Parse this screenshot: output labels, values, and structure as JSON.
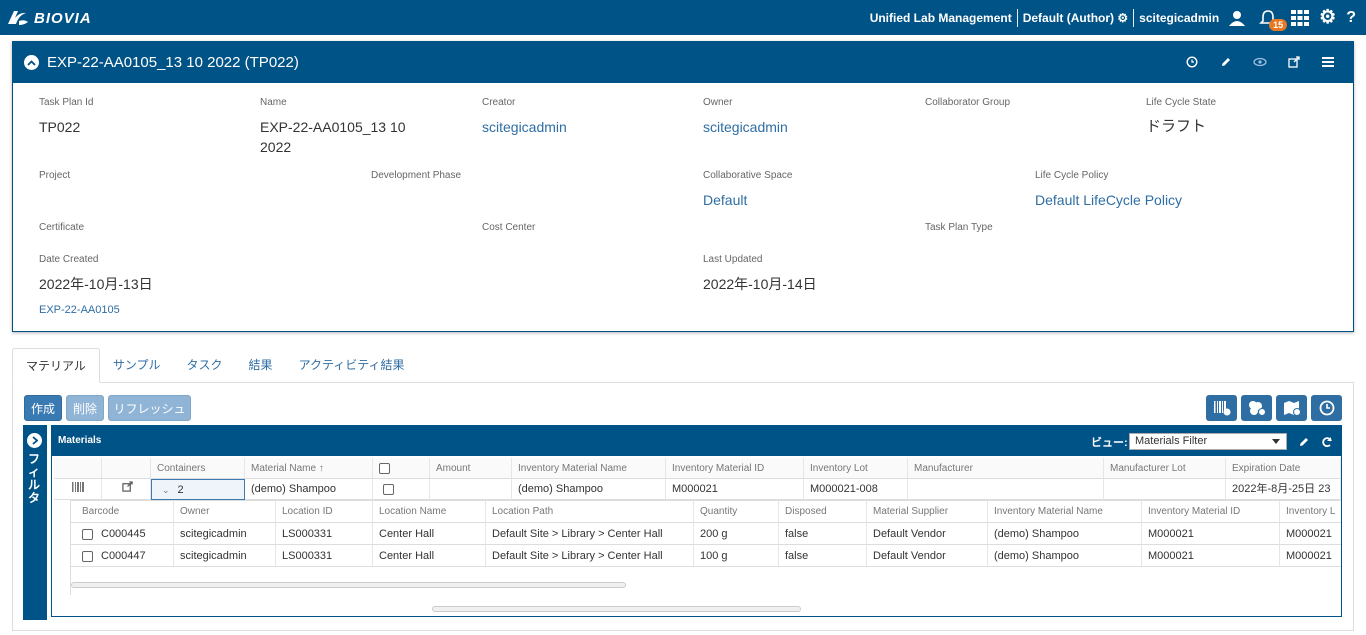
{
  "topbar": {
    "brand": "BIOVIA",
    "app_name": "Unified Lab Management",
    "role": "Default (Author)",
    "user": "scitegicadmin",
    "notification_count": "15",
    "icons": [
      "user-icon",
      "bell-icon",
      "grid-icon",
      "gear-icon",
      "help-icon"
    ]
  },
  "panel": {
    "title": "EXP-22-AA0105_13 10 2022 (TP022)",
    "fields": {
      "task_plan_id": {
        "label": "Task Plan Id",
        "value": "TP022"
      },
      "name": {
        "label": "Name",
        "value": "EXP-22-AA0105_13 10 2022"
      },
      "creator": {
        "label": "Creator",
        "value": "scitegicadmin"
      },
      "owner": {
        "label": "Owner",
        "value": "scitegicadmin"
      },
      "collaborator_group": {
        "label": "Collaborator Group",
        "value": ""
      },
      "life_cycle_state": {
        "label": "Life Cycle State",
        "value": "ドラフト"
      },
      "project": {
        "label": "Project",
        "value": ""
      },
      "development_phase": {
        "label": "Development Phase",
        "value": ""
      },
      "collaborative_space": {
        "label": "Collaborative Space",
        "value": "Default"
      },
      "life_cycle_policy": {
        "label": "Life Cycle Policy",
        "value": "Default LifeCycle Policy"
      },
      "certificate": {
        "label": "Certificate",
        "value": ""
      },
      "cost_center": {
        "label": "Cost Center",
        "value": ""
      },
      "task_plan_type": {
        "label": "Task Plan Type",
        "value": ""
      },
      "date_created": {
        "label": "Date Created",
        "value": "2022年-10月-13日"
      },
      "last_updated": {
        "label": "Last Updated",
        "value": "2022年-10月-14日"
      }
    },
    "experiment_link": "EXP-22-AA0105"
  },
  "tabs": [
    "マテリアル",
    "サンプル",
    "タスク",
    "結果",
    "アクティビティ結果"
  ],
  "toolbar": {
    "create": "作成",
    "delete": "削除",
    "refresh": "リフレッシュ"
  },
  "filter_sidebar": {
    "label": "フィルタ"
  },
  "materials": {
    "title": "Materials",
    "view_label": "ビュー:",
    "view_selected": "Materials Filter",
    "columns": [
      "",
      "",
      "Containers",
      "Material Name",
      "",
      "Amount",
      "Inventory Material Name",
      "Inventory Material ID",
      "Inventory Lot",
      "Manufacturer",
      "Manufacturer Lot",
      "Expiration Date"
    ],
    "sort_indicator": "↑",
    "row": {
      "containers": "2",
      "material_name": "(demo) Shampoo",
      "amount": "",
      "inventory_material_name": "(demo) Shampoo",
      "inventory_material_id": "M000021",
      "inventory_lot": "M000021-008",
      "manufacturer": "",
      "manufacturer_lot": "",
      "expiration_date": "2022年-8月-25日 23"
    },
    "containers": {
      "columns": [
        "Barcode",
        "Owner",
        "Location ID",
        "Location Name",
        "Location Path",
        "Quantity",
        "Disposed",
        "Material Supplier",
        "Inventory Material Name",
        "Inventory Material ID",
        "Inventory L"
      ],
      "rows": [
        [
          "C000445",
          "scitegicadmin",
          "LS000331",
          "Center Hall",
          "Default Site > Library > Center Hall",
          "200 g",
          "false",
          "Default Vendor",
          "(demo) Shampoo",
          "M000021",
          "M000021"
        ],
        [
          "C000447",
          "scitegicadmin",
          "LS000331",
          "Center Hall",
          "Default Site > Library > Center Hall",
          "100 g",
          "false",
          "Default Vendor",
          "(demo) Shampoo",
          "M000021",
          "M000021"
        ]
      ]
    }
  },
  "colors": {
    "brand": "#005386",
    "link": "#2f6ea3",
    "badge": "#e87722"
  }
}
